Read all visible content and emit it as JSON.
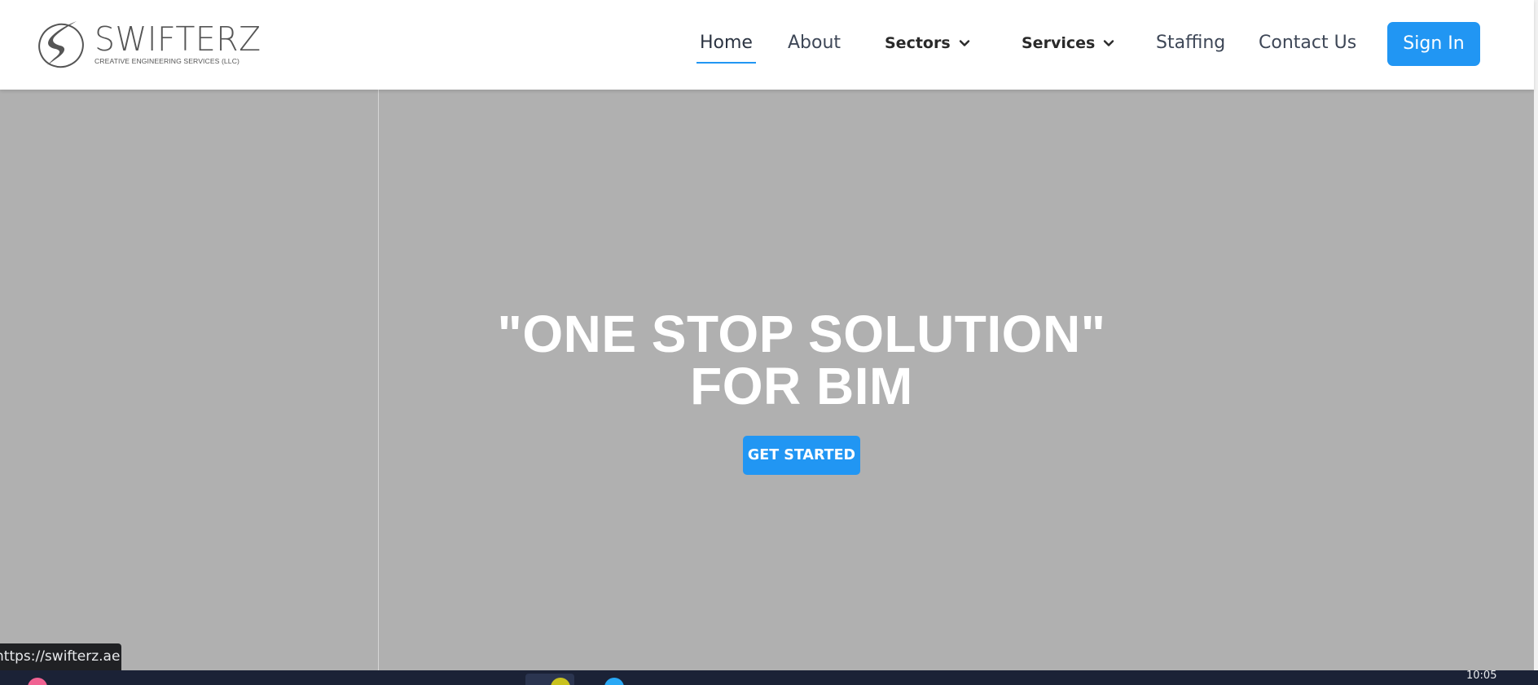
{
  "header": {
    "brand": {
      "name": "SWIFTERZ",
      "tagline": "CREATIVE ENGINEERING SERVICES (LLC)"
    },
    "nav": {
      "home": "Home",
      "about": "About",
      "sectors": "Sectors",
      "services": "Services",
      "staffing": "Staffing",
      "contact": "Contact Us"
    },
    "sign_in": "Sign In"
  },
  "hero": {
    "title_line1": "\"ONE STOP SOLUTION\"",
    "title_line2": "FOR BIM",
    "cta": "GET STARTED"
  },
  "status_bar": {
    "url": "https://swifterz.ae"
  },
  "taskbar": {
    "clock": "10:05"
  },
  "colors": {
    "accent": "#2196f3",
    "hero_overlay": "#b0b0b0",
    "nav_text": "#3e4757",
    "logo_grey": "#555555"
  },
  "icons": {
    "logo": "swifterz-logo-icon",
    "dropdown": "chevron-down-icon"
  }
}
